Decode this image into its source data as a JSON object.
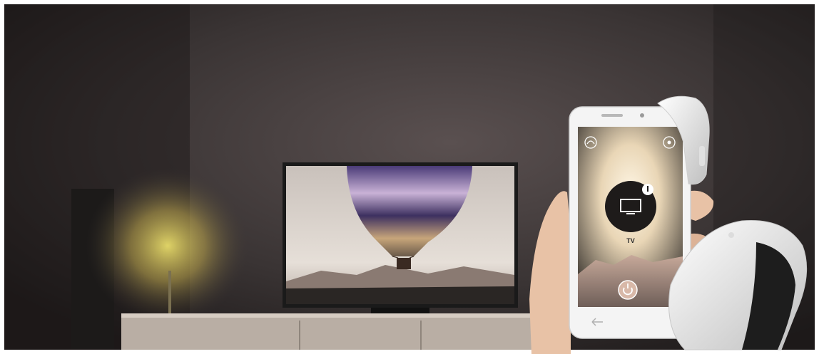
{
  "scene": {
    "description_free": true,
    "palette": {
      "wall": "#3a3434",
      "wall_dark": "#1f1b1b",
      "lamp_glow": "#d9c86a",
      "tv_frame": "#1a1a1a",
      "sky": "#e2dcd6",
      "balloon_top": "#5b4a8a",
      "balloon_mid": "#d2b488",
      "phone_body": "#f4f4f4",
      "phone_screen_top": "#3a3530",
      "phone_screen_glow": "#f3e6cf",
      "hearing_aid": "#f0f0f0",
      "skin": "#e8c2a6",
      "cabinet": "#b9aea4"
    }
  },
  "phone_app": {
    "device_label": "TV",
    "top_left_icon": "headset-icon",
    "top_right_icon": "settings-icon",
    "center_icon": "tv-icon",
    "bottom_icon": "power-icon",
    "nav_icon": "back-icon"
  }
}
